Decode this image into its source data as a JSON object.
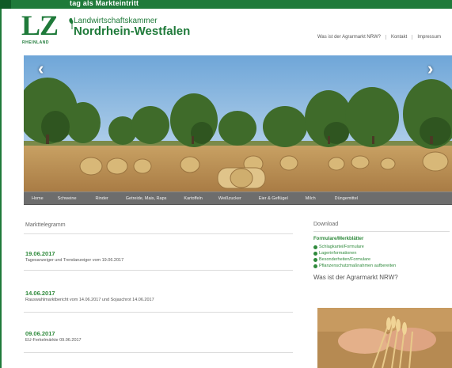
{
  "window": {
    "title": "tag als Markteintritt",
    "accent": "#1f7a3a"
  },
  "header": {
    "logo_main": "LZ",
    "logo_sub": "RHEINLAND",
    "chamber_line1": "Landwirtschaftskammer",
    "chamber_line2": "Nordrhein-Westfalen",
    "nav": [
      "Was ist der Agrarmarkt NRW?",
      "Kontakt",
      "Impressum"
    ]
  },
  "slider": {
    "prev_icon": "chevron-left-icon",
    "next_icon": "chevron-right-icon"
  },
  "menu": {
    "items": [
      "Home",
      "Schweine",
      "Rinder",
      "Getreide, Mais, Raps",
      "Kartoffeln",
      "Weißzucker",
      "Eier & Geflügel",
      "Milch",
      "Düngemittel"
    ]
  },
  "main": {
    "section_title": "Markttelegramm",
    "news": [
      {
        "date": "19.06.2017",
        "text": "Tagesanzeiger und Trendanzeiger vom 19.06.2017"
      },
      {
        "date": "14.06.2017",
        "text": "Rauswahlmarktbericht vom 14.06.2017 und Sojaschrot 14.06.2017"
      },
      {
        "date": "09.06.2017",
        "text": "EU-Ferkelmärkte 09.06.2017"
      }
    ]
  },
  "sidebar": {
    "download_title": "Download",
    "forms_heading": "Formulare/Merkblätter",
    "links": [
      "Schlagkartei/Formulare",
      "Lagerinformationen",
      "Besonderheiten/Formulare",
      "Pflanzenschutzmaßnahmen aufbereiten"
    ],
    "agrar_title": "Was ist der Agrarmarkt NRW?"
  }
}
